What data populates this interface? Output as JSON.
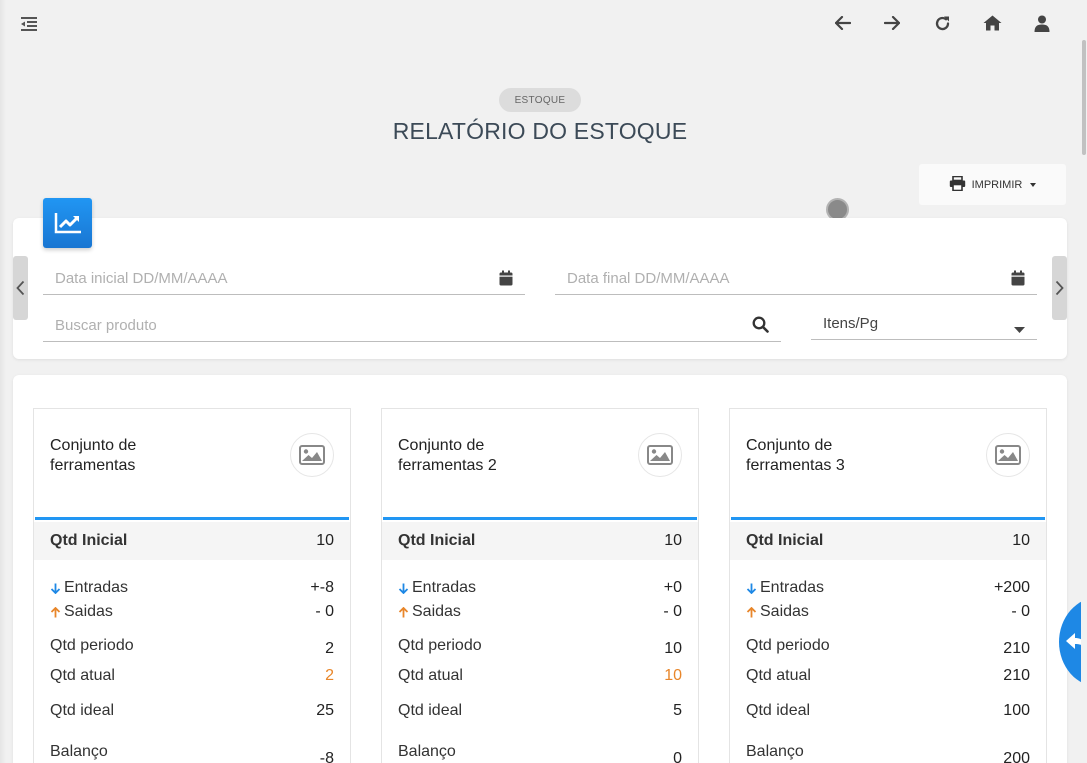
{
  "header": {
    "menu_icon": "menu-collapse-icon",
    "nav_icons": [
      "arrow-left-icon",
      "arrow-right-icon",
      "refresh-icon",
      "home-icon",
      "user-icon"
    ]
  },
  "page": {
    "badge": "ESTOQUE",
    "title": "RELATÓRIO DO ESTOQUE"
  },
  "toolbar": {
    "print_label": "IMPRIMIR"
  },
  "filters": {
    "start_date_placeholder": "Data inicial DD/MM/AAAA",
    "end_date_placeholder": "Data final DD/MM/AAAA",
    "search_placeholder": "Buscar produto",
    "items_per_page_label": "Itens/Pg"
  },
  "colors": {
    "accent": "#2196f3",
    "accent_dark": "#1976d2",
    "orange": "#e8862a"
  },
  "products": [
    {
      "name_line1": "Conjunto de",
      "name_line2": "ferramentas",
      "qtd_inicial_label": "Qtd Inicial",
      "qtd_inicial": "10",
      "entradas_label": "Entradas",
      "entradas": "+-8",
      "saidas_label": "Saidas",
      "saidas": "- 0",
      "qtd_periodo_label": "Qtd periodo",
      "qtd_periodo": "2",
      "qtd_atual_label": "Qtd atual",
      "qtd_atual": "2",
      "qtd_ideal_label": "Qtd ideal",
      "qtd_ideal": "25",
      "balanco_label": "Balanço",
      "balanco": "-8"
    },
    {
      "name_line1": "Conjunto de",
      "name_line2": "ferramentas 2",
      "qtd_inicial_label": "Qtd Inicial",
      "qtd_inicial": "10",
      "entradas_label": "Entradas",
      "entradas": "+0",
      "saidas_label": "Saidas",
      "saidas": "- 0",
      "qtd_periodo_label": "Qtd periodo",
      "qtd_periodo": "10",
      "qtd_atual_label": "Qtd atual",
      "qtd_atual": "10",
      "qtd_ideal_label": "Qtd ideal",
      "qtd_ideal": "5",
      "balanco_label": "Balanço",
      "balanco": "0"
    },
    {
      "name_line1": "Conjunto de",
      "name_line2": "ferramentas 3",
      "qtd_inicial_label": "Qtd Inicial",
      "qtd_inicial": "10",
      "entradas_label": "Entradas",
      "entradas": "+200",
      "saidas_label": "Saidas",
      "saidas": "- 0",
      "qtd_periodo_label": "Qtd periodo",
      "qtd_periodo": "210",
      "qtd_atual_label": "Qtd atual",
      "qtd_atual": "210",
      "qtd_ideal_label": "Qtd ideal",
      "qtd_ideal": "100",
      "balanco_label": "Balanço",
      "balanco": "200"
    }
  ]
}
